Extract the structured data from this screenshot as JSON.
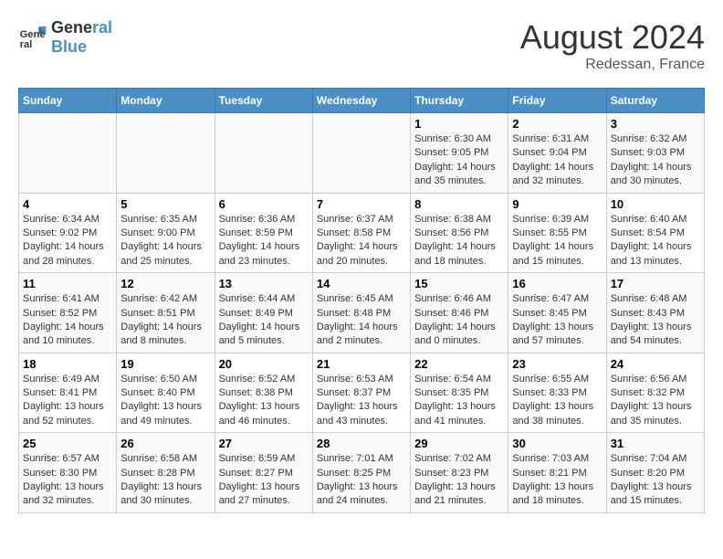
{
  "header": {
    "logo_line1": "General",
    "logo_line2": "Blue",
    "month_year": "August 2024",
    "location": "Redessan, France"
  },
  "weekdays": [
    "Sunday",
    "Monday",
    "Tuesday",
    "Wednesday",
    "Thursday",
    "Friday",
    "Saturday"
  ],
  "weeks": [
    [
      {
        "day": "",
        "info": ""
      },
      {
        "day": "",
        "info": ""
      },
      {
        "day": "",
        "info": ""
      },
      {
        "day": "",
        "info": ""
      },
      {
        "day": "1",
        "info": "Sunrise: 6:30 AM\nSunset: 9:05 PM\nDaylight: 14 hours and 35 minutes."
      },
      {
        "day": "2",
        "info": "Sunrise: 6:31 AM\nSunset: 9:04 PM\nDaylight: 14 hours and 32 minutes."
      },
      {
        "day": "3",
        "info": "Sunrise: 6:32 AM\nSunset: 9:03 PM\nDaylight: 14 hours and 30 minutes."
      }
    ],
    [
      {
        "day": "4",
        "info": "Sunrise: 6:34 AM\nSunset: 9:02 PM\nDaylight: 14 hours and 28 minutes."
      },
      {
        "day": "5",
        "info": "Sunrise: 6:35 AM\nSunset: 9:00 PM\nDaylight: 14 hours and 25 minutes."
      },
      {
        "day": "6",
        "info": "Sunrise: 6:36 AM\nSunset: 8:59 PM\nDaylight: 14 hours and 23 minutes."
      },
      {
        "day": "7",
        "info": "Sunrise: 6:37 AM\nSunset: 8:58 PM\nDaylight: 14 hours and 20 minutes."
      },
      {
        "day": "8",
        "info": "Sunrise: 6:38 AM\nSunset: 8:56 PM\nDaylight: 14 hours and 18 minutes."
      },
      {
        "day": "9",
        "info": "Sunrise: 6:39 AM\nSunset: 8:55 PM\nDaylight: 14 hours and 15 minutes."
      },
      {
        "day": "10",
        "info": "Sunrise: 6:40 AM\nSunset: 8:54 PM\nDaylight: 14 hours and 13 minutes."
      }
    ],
    [
      {
        "day": "11",
        "info": "Sunrise: 6:41 AM\nSunset: 8:52 PM\nDaylight: 14 hours and 10 minutes."
      },
      {
        "day": "12",
        "info": "Sunrise: 6:42 AM\nSunset: 8:51 PM\nDaylight: 14 hours and 8 minutes."
      },
      {
        "day": "13",
        "info": "Sunrise: 6:44 AM\nSunset: 8:49 PM\nDaylight: 14 hours and 5 minutes."
      },
      {
        "day": "14",
        "info": "Sunrise: 6:45 AM\nSunset: 8:48 PM\nDaylight: 14 hours and 2 minutes."
      },
      {
        "day": "15",
        "info": "Sunrise: 6:46 AM\nSunset: 8:46 PM\nDaylight: 14 hours and 0 minutes."
      },
      {
        "day": "16",
        "info": "Sunrise: 6:47 AM\nSunset: 8:45 PM\nDaylight: 13 hours and 57 minutes."
      },
      {
        "day": "17",
        "info": "Sunrise: 6:48 AM\nSunset: 8:43 PM\nDaylight: 13 hours and 54 minutes."
      }
    ],
    [
      {
        "day": "18",
        "info": "Sunrise: 6:49 AM\nSunset: 8:41 PM\nDaylight: 13 hours and 52 minutes."
      },
      {
        "day": "19",
        "info": "Sunrise: 6:50 AM\nSunset: 8:40 PM\nDaylight: 13 hours and 49 minutes."
      },
      {
        "day": "20",
        "info": "Sunrise: 6:52 AM\nSunset: 8:38 PM\nDaylight: 13 hours and 46 minutes."
      },
      {
        "day": "21",
        "info": "Sunrise: 6:53 AM\nSunset: 8:37 PM\nDaylight: 13 hours and 43 minutes."
      },
      {
        "day": "22",
        "info": "Sunrise: 6:54 AM\nSunset: 8:35 PM\nDaylight: 13 hours and 41 minutes."
      },
      {
        "day": "23",
        "info": "Sunrise: 6:55 AM\nSunset: 8:33 PM\nDaylight: 13 hours and 38 minutes."
      },
      {
        "day": "24",
        "info": "Sunrise: 6:56 AM\nSunset: 8:32 PM\nDaylight: 13 hours and 35 minutes."
      }
    ],
    [
      {
        "day": "25",
        "info": "Sunrise: 6:57 AM\nSunset: 8:30 PM\nDaylight: 13 hours and 32 minutes."
      },
      {
        "day": "26",
        "info": "Sunrise: 6:58 AM\nSunset: 8:28 PM\nDaylight: 13 hours and 30 minutes."
      },
      {
        "day": "27",
        "info": "Sunrise: 6:59 AM\nSunset: 8:27 PM\nDaylight: 13 hours and 27 minutes."
      },
      {
        "day": "28",
        "info": "Sunrise: 7:01 AM\nSunset: 8:25 PM\nDaylight: 13 hours and 24 minutes."
      },
      {
        "day": "29",
        "info": "Sunrise: 7:02 AM\nSunset: 8:23 PM\nDaylight: 13 hours and 21 minutes."
      },
      {
        "day": "30",
        "info": "Sunrise: 7:03 AM\nSunset: 8:21 PM\nDaylight: 13 hours and 18 minutes."
      },
      {
        "day": "31",
        "info": "Sunrise: 7:04 AM\nSunset: 8:20 PM\nDaylight: 13 hours and 15 minutes."
      }
    ]
  ]
}
